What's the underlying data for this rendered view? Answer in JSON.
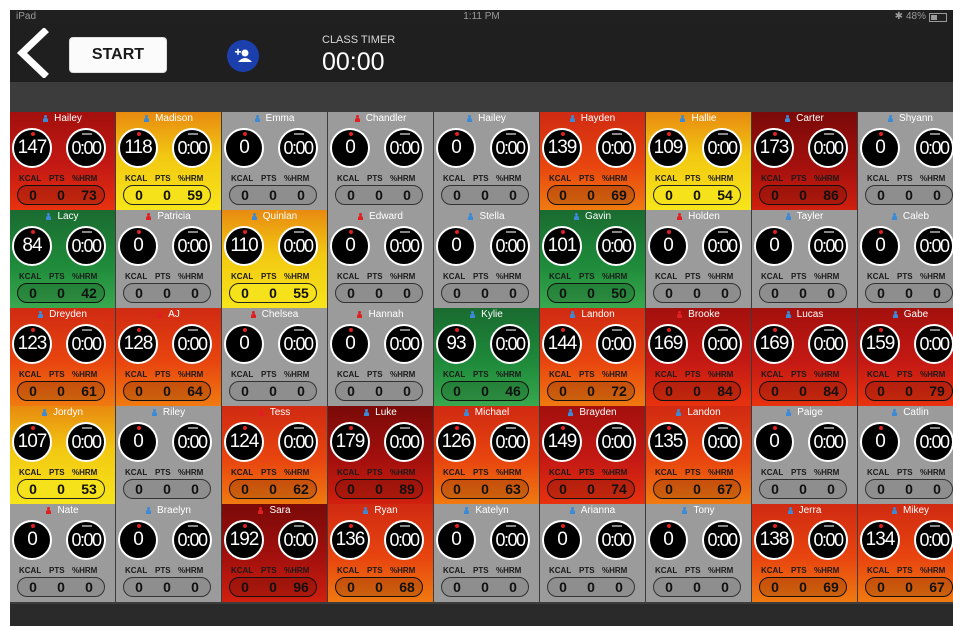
{
  "status_bar": {
    "device": "iPad",
    "time": "1:11 PM",
    "battery": "48%"
  },
  "header": {
    "start_label": "START",
    "timer_label": "CLASS TIMER",
    "timer_value": "00:00"
  },
  "tile_labels": {
    "kcal": "KCAL",
    "pts": "PTS",
    "hrm": "%HRM"
  },
  "colors": {
    "red": "#c41914",
    "orange": "#e8450f",
    "yellow": "#f2c812",
    "green": "#1e8a3a",
    "gray": "#9b9b9b",
    "darkred": "#a3100d"
  },
  "tiles": [
    {
      "name": "Hailey",
      "sex": "male",
      "hr": "147",
      "time": "0:00",
      "kcal": "0",
      "pts": "0",
      "hrm": "73",
      "zone": "red"
    },
    {
      "name": "Madison",
      "sex": "male",
      "hr": "118",
      "time": "0:00",
      "kcal": "0",
      "pts": "0",
      "hrm": "59",
      "zone": "yellow"
    },
    {
      "name": "Emma",
      "sex": "male",
      "hr": "0",
      "time": "0:00",
      "kcal": "0",
      "pts": "0",
      "hrm": "0",
      "zone": "gray"
    },
    {
      "name": "Chandler",
      "sex": "female",
      "hr": "0",
      "time": "0:00",
      "kcal": "0",
      "pts": "0",
      "hrm": "0",
      "zone": "gray"
    },
    {
      "name": "Hailey",
      "sex": "male",
      "hr": "0",
      "time": "0:00",
      "kcal": "0",
      "pts": "0",
      "hrm": "0",
      "zone": "gray"
    },
    {
      "name": "Hayden",
      "sex": "male",
      "hr": "139",
      "time": "0:00",
      "kcal": "0",
      "pts": "0",
      "hrm": "69",
      "zone": "orange"
    },
    {
      "name": "Hallie",
      "sex": "male",
      "hr": "109",
      "time": "0:00",
      "kcal": "0",
      "pts": "0",
      "hrm": "54",
      "zone": "yellow"
    },
    {
      "name": "Carter",
      "sex": "male",
      "hr": "173",
      "time": "0:00",
      "kcal": "0",
      "pts": "0",
      "hrm": "86",
      "zone": "darkred"
    },
    {
      "name": "Shyann",
      "sex": "male",
      "hr": "0",
      "time": "0:00",
      "kcal": "0",
      "pts": "0",
      "hrm": "0",
      "zone": "gray"
    },
    {
      "name": "Lacy",
      "sex": "male",
      "hr": "84",
      "time": "0:00",
      "kcal": "0",
      "pts": "0",
      "hrm": "42",
      "zone": "green"
    },
    {
      "name": "Patricia",
      "sex": "female",
      "hr": "0",
      "time": "0:00",
      "kcal": "0",
      "pts": "0",
      "hrm": "0",
      "zone": "gray"
    },
    {
      "name": "Quinlan",
      "sex": "male",
      "hr": "110",
      "time": "0:00",
      "kcal": "0",
      "pts": "0",
      "hrm": "55",
      "zone": "yellow"
    },
    {
      "name": "Edward",
      "sex": "female",
      "hr": "0",
      "time": "0:00",
      "kcal": "0",
      "pts": "0",
      "hrm": "0",
      "zone": "gray"
    },
    {
      "name": "Stella",
      "sex": "male",
      "hr": "0",
      "time": "0:00",
      "kcal": "0",
      "pts": "0",
      "hrm": "0",
      "zone": "gray"
    },
    {
      "name": "Gavin",
      "sex": "male",
      "hr": "101",
      "time": "0:00",
      "kcal": "0",
      "pts": "0",
      "hrm": "50",
      "zone": "green"
    },
    {
      "name": "Holden",
      "sex": "female",
      "hr": "0",
      "time": "0:00",
      "kcal": "0",
      "pts": "0",
      "hrm": "0",
      "zone": "gray"
    },
    {
      "name": "Tayler",
      "sex": "male",
      "hr": "0",
      "time": "0:00",
      "kcal": "0",
      "pts": "0",
      "hrm": "0",
      "zone": "gray"
    },
    {
      "name": "Caleb",
      "sex": "male",
      "hr": "0",
      "time": "0:00",
      "kcal": "0",
      "pts": "0",
      "hrm": "0",
      "zone": "gray"
    },
    {
      "name": "Dreyden",
      "sex": "male",
      "hr": "123",
      "time": "0:00",
      "kcal": "0",
      "pts": "0",
      "hrm": "61",
      "zone": "orange"
    },
    {
      "name": "AJ",
      "sex": "female",
      "hr": "128",
      "time": "0:00",
      "kcal": "0",
      "pts": "0",
      "hrm": "64",
      "zone": "orange"
    },
    {
      "name": "Chelsea",
      "sex": "female",
      "hr": "0",
      "time": "0:00",
      "kcal": "0",
      "pts": "0",
      "hrm": "0",
      "zone": "gray"
    },
    {
      "name": "Hannah",
      "sex": "female",
      "hr": "0",
      "time": "0:00",
      "kcal": "0",
      "pts": "0",
      "hrm": "0",
      "zone": "gray"
    },
    {
      "name": "Kylie",
      "sex": "male",
      "hr": "93",
      "time": "0:00",
      "kcal": "0",
      "pts": "0",
      "hrm": "46",
      "zone": "green"
    },
    {
      "name": "Landon",
      "sex": "male",
      "hr": "144",
      "time": "0:00",
      "kcal": "0",
      "pts": "0",
      "hrm": "72",
      "zone": "orange"
    },
    {
      "name": "Brooke",
      "sex": "female",
      "hr": "169",
      "time": "0:00",
      "kcal": "0",
      "pts": "0",
      "hrm": "84",
      "zone": "red"
    },
    {
      "name": "Lucas",
      "sex": "male",
      "hr": "169",
      "time": "0:00",
      "kcal": "0",
      "pts": "0",
      "hrm": "84",
      "zone": "red"
    },
    {
      "name": "Gabe",
      "sex": "male",
      "hr": "159",
      "time": "0:00",
      "kcal": "0",
      "pts": "0",
      "hrm": "79",
      "zone": "red"
    },
    {
      "name": "Jordyn",
      "sex": "male",
      "hr": "107",
      "time": "0:00",
      "kcal": "0",
      "pts": "0",
      "hrm": "53",
      "zone": "yellow"
    },
    {
      "name": "Riley",
      "sex": "male",
      "hr": "0",
      "time": "0:00",
      "kcal": "0",
      "pts": "0",
      "hrm": "0",
      "zone": "gray"
    },
    {
      "name": "Tess",
      "sex": "female",
      "hr": "124",
      "time": "0:00",
      "kcal": "0",
      "pts": "0",
      "hrm": "62",
      "zone": "orange"
    },
    {
      "name": "Luke",
      "sex": "male",
      "hr": "179",
      "time": "0:00",
      "kcal": "0",
      "pts": "0",
      "hrm": "89",
      "zone": "darkred"
    },
    {
      "name": "Michael",
      "sex": "male",
      "hr": "126",
      "time": "0:00",
      "kcal": "0",
      "pts": "0",
      "hrm": "63",
      "zone": "orange"
    },
    {
      "name": "Brayden",
      "sex": "male",
      "hr": "149",
      "time": "0:00",
      "kcal": "0",
      "pts": "0",
      "hrm": "74",
      "zone": "red"
    },
    {
      "name": "Landon",
      "sex": "male",
      "hr": "135",
      "time": "0:00",
      "kcal": "0",
      "pts": "0",
      "hrm": "67",
      "zone": "orange"
    },
    {
      "name": "Paige",
      "sex": "male",
      "hr": "0",
      "time": "0:00",
      "kcal": "0",
      "pts": "0",
      "hrm": "0",
      "zone": "gray"
    },
    {
      "name": "Catlin",
      "sex": "male",
      "hr": "0",
      "time": "0:00",
      "kcal": "0",
      "pts": "0",
      "hrm": "0",
      "zone": "gray"
    },
    {
      "name": "Nate",
      "sex": "female",
      "hr": "0",
      "time": "0:00",
      "kcal": "0",
      "pts": "0",
      "hrm": "0",
      "zone": "gray"
    },
    {
      "name": "Braelyn",
      "sex": "male",
      "hr": "0",
      "time": "0:00",
      "kcal": "0",
      "pts": "0",
      "hrm": "0",
      "zone": "gray"
    },
    {
      "name": "Sara",
      "sex": "female",
      "hr": "192",
      "time": "0:00",
      "kcal": "0",
      "pts": "0",
      "hrm": "96",
      "zone": "darkred"
    },
    {
      "name": "Ryan",
      "sex": "male",
      "hr": "136",
      "time": "0:00",
      "kcal": "0",
      "pts": "0",
      "hrm": "68",
      "zone": "orange"
    },
    {
      "name": "Katelyn",
      "sex": "male",
      "hr": "0",
      "time": "0:00",
      "kcal": "0",
      "pts": "0",
      "hrm": "0",
      "zone": "gray"
    },
    {
      "name": "Arianna",
      "sex": "male",
      "hr": "0",
      "time": "0:00",
      "kcal": "0",
      "pts": "0",
      "hrm": "0",
      "zone": "gray"
    },
    {
      "name": "Tony",
      "sex": "male",
      "hr": "0",
      "time": "0:00",
      "kcal": "0",
      "pts": "0",
      "hrm": "0",
      "zone": "gray"
    },
    {
      "name": "Jerra",
      "sex": "male",
      "hr": "138",
      "time": "0:00",
      "kcal": "0",
      "pts": "0",
      "hrm": "69",
      "zone": "orange"
    },
    {
      "name": "Mikey",
      "sex": "male",
      "hr": "134",
      "time": "0:00",
      "kcal": "0",
      "pts": "0",
      "hrm": "67",
      "zone": "orange"
    }
  ]
}
